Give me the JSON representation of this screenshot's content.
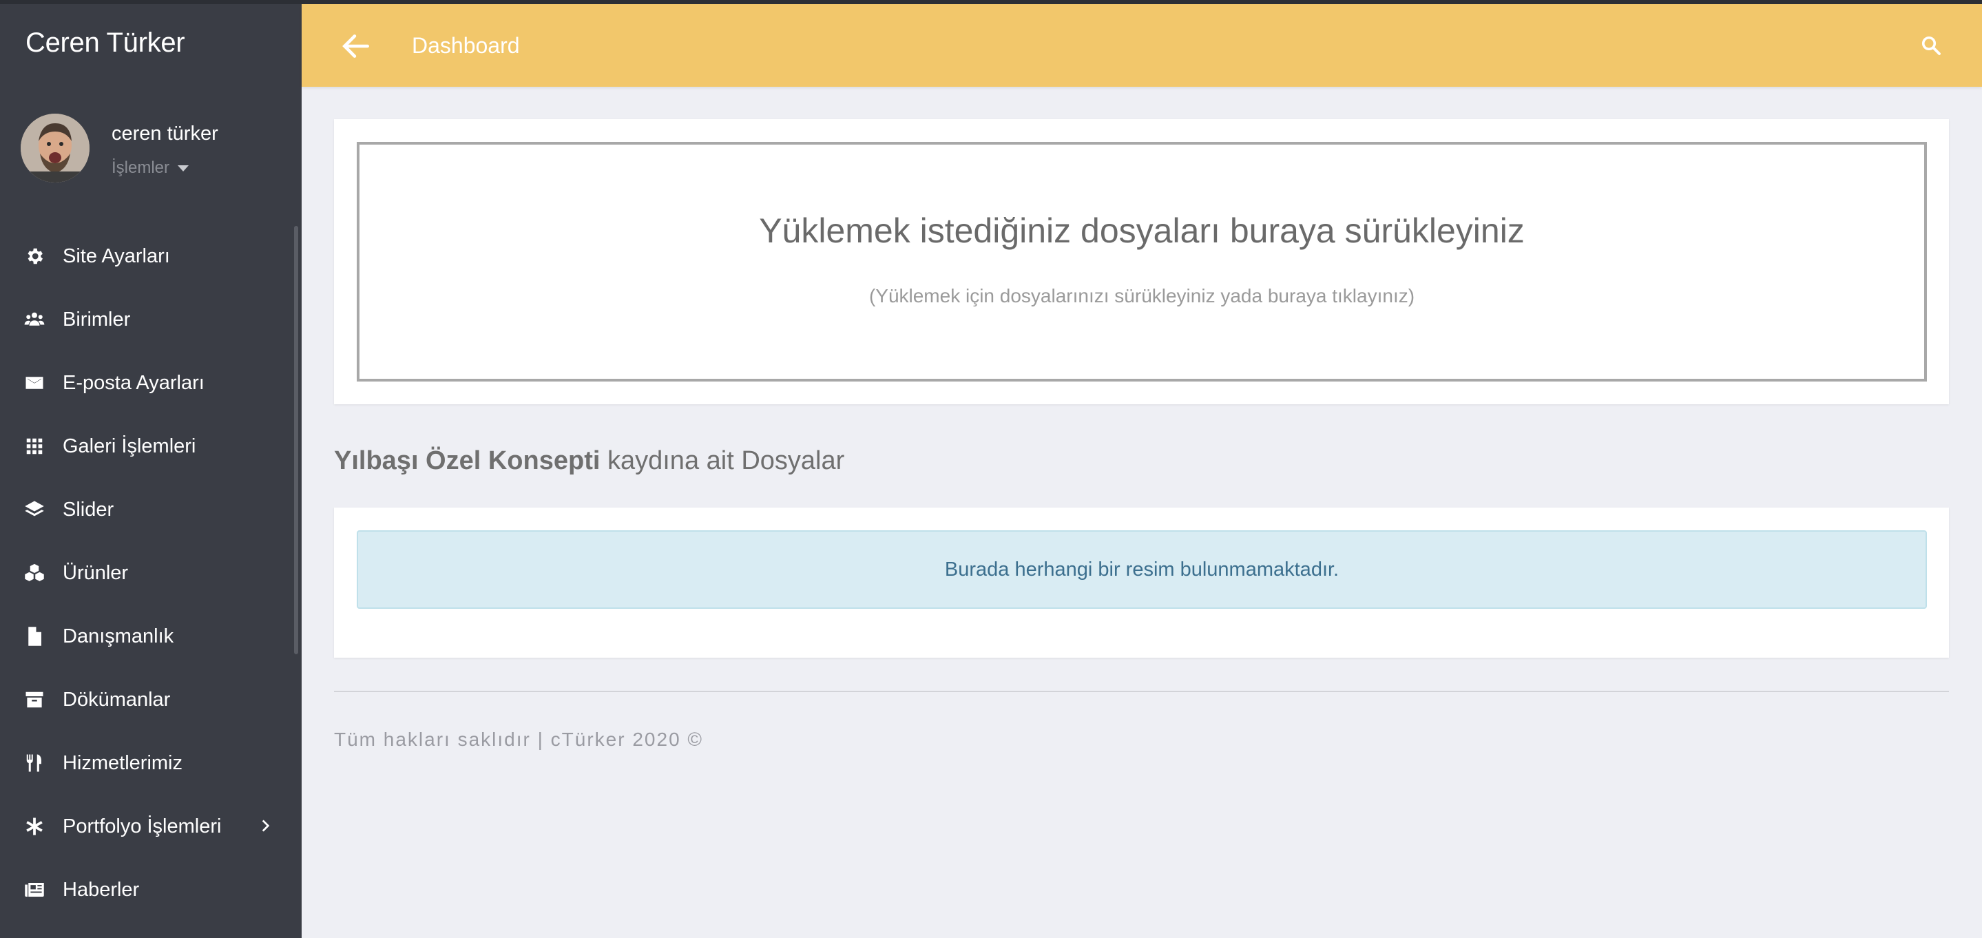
{
  "sidebar": {
    "brand": "Ceren Türker",
    "user": {
      "name": "ceren türker",
      "actions_label": "İşlemler"
    },
    "items": [
      {
        "label": "Site Ayarları",
        "icon": "gear-icon"
      },
      {
        "label": "Birimler",
        "icon": "users-icon"
      },
      {
        "label": "E-posta Ayarları",
        "icon": "envelope-icon"
      },
      {
        "label": "Galeri İşlemleri",
        "icon": "grid-icon"
      },
      {
        "label": "Slider",
        "icon": "layers-icon"
      },
      {
        "label": "Ürünler",
        "icon": "cubes-icon"
      },
      {
        "label": "Danışmanlık",
        "icon": "file-icon"
      },
      {
        "label": "Dökümanlar",
        "icon": "archive-icon"
      },
      {
        "label": "Hizmetlerimiz",
        "icon": "utensils-icon"
      },
      {
        "label": "Portfolyo İşlemleri",
        "icon": "asterisk-icon"
      },
      {
        "label": "Haberler",
        "icon": "newspaper-icon"
      }
    ]
  },
  "header": {
    "title": "Dashboard"
  },
  "dropzone": {
    "title": "Yüklemek istediğiniz dosyaları buraya sürükleyiniz",
    "subtitle": "(Yüklemek için dosyalarınızı sürükleyiniz yada buraya tıklayınız)"
  },
  "section": {
    "title_bold": "Yılbaşı Özel Konsepti",
    "title_rest": "kaydına ait Dosyalar"
  },
  "alert": {
    "text": "Burada herhangi bir resim bulunmamaktadır."
  },
  "footer": {
    "text": "Tüm hakları saklıdır | cTürker 2020 ©"
  },
  "colors": {
    "header": "#f2c76b",
    "sidebar": "#3a3d45",
    "alert_bg": "#d9ecf3",
    "alert_text": "#3c6f8e"
  }
}
